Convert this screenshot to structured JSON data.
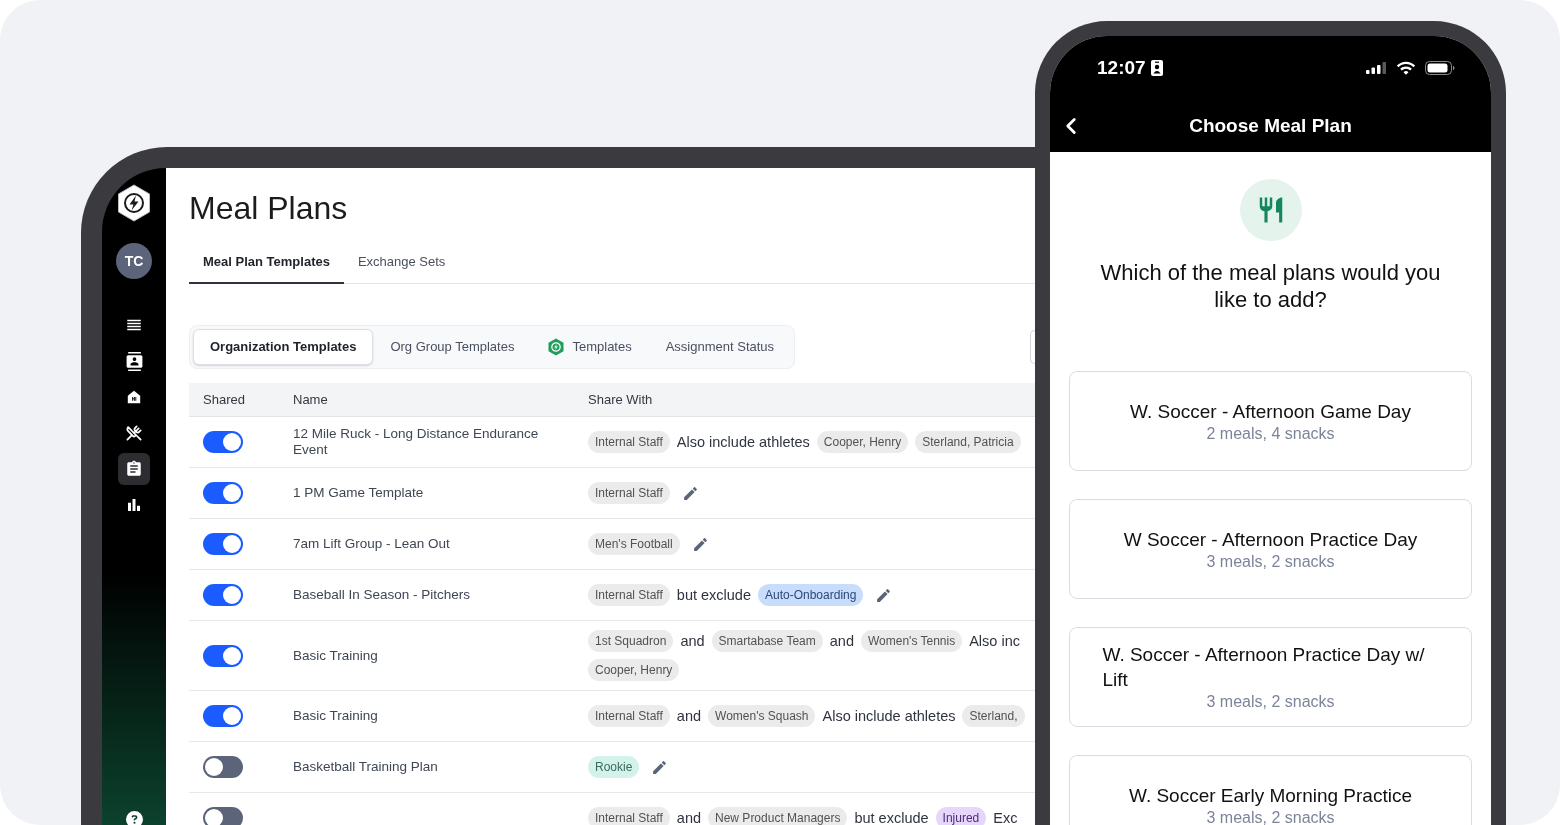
{
  "tablet": {
    "sidebar": {
      "avatar": "TC",
      "nav": [
        {
          "selected": false
        },
        {
          "selected": false
        },
        {
          "selected": false
        },
        {
          "selected": false
        },
        {
          "selected": true
        },
        {
          "selected": false
        }
      ]
    },
    "title": "Meal Plans",
    "tabs": [
      {
        "label": "Meal Plan Templates",
        "selected": true
      },
      {
        "label": "Exchange Sets",
        "selected": false
      }
    ],
    "segments": [
      {
        "label": "Organization Templates",
        "kind": "plain",
        "selected": true
      },
      {
        "label": "Org Group Templates",
        "kind": "plain",
        "selected": false
      },
      {
        "label": "Templates",
        "kind": "badged",
        "selected": false
      },
      {
        "label": "Assignment Status",
        "kind": "plain",
        "selected": false
      }
    ],
    "table": {
      "columns": [
        "Shared",
        "Name",
        "Share With"
      ],
      "rows": [
        {
          "shared": true,
          "name": "12 Mile Ruck - Long Distance Endurance Event",
          "share_with": [
            [
              {
                "kind": "chip",
                "text": "Internal Staff",
                "color": "#ebebeb"
              },
              {
                "kind": "text",
                "text": "Also include athletes"
              },
              {
                "kind": "chip",
                "text": "Cooper, Henry",
                "color": "#ebebeb"
              },
              {
                "kind": "chip",
                "text": "Sterland, Patricia",
                "color": "#ebebeb"
              }
            ]
          ]
        },
        {
          "shared": true,
          "name": "1 PM Game Template",
          "share_with": [
            [
              {
                "kind": "chip",
                "text": "Internal Staff",
                "color": "#ebebeb"
              },
              {
                "kind": "edit"
              }
            ]
          ]
        },
        {
          "shared": true,
          "name": "7am Lift Group - Lean Out",
          "share_with": [
            [
              {
                "kind": "chip",
                "text": "Men's Football",
                "color": "#ebebeb"
              },
              {
                "kind": "edit"
              }
            ]
          ]
        },
        {
          "shared": true,
          "name": "Baseball In Season - Pitchers",
          "share_with": [
            [
              {
                "kind": "chip",
                "text": "Internal Staff",
                "color": "#ebebeb"
              },
              {
                "kind": "text",
                "text": "but exclude"
              },
              {
                "kind": "chip",
                "text": "Auto-Onboarding",
                "color": "#c8dcfb"
              },
              {
                "kind": "edit"
              }
            ]
          ]
        },
        {
          "shared": true,
          "name": "Basic Training",
          "share_with": [
            [
              {
                "kind": "chip",
                "text": "1st Squadron",
                "color": "#ebebeb"
              },
              {
                "kind": "text",
                "text": "and"
              },
              {
                "kind": "chip",
                "text": "Smartabase Team",
                "color": "#ebebeb"
              },
              {
                "kind": "text",
                "text": "and"
              },
              {
                "kind": "chip",
                "text": "Women's Tennis",
                "color": "#ebebeb"
              },
              {
                "kind": "text",
                "text": "Also inc"
              }
            ],
            [
              {
                "kind": "chip",
                "text": "Cooper, Henry",
                "color": "#ebebeb"
              }
            ]
          ]
        },
        {
          "shared": true,
          "name": "Basic Training",
          "share_with": [
            [
              {
                "kind": "chip",
                "text": "Internal Staff",
                "color": "#ebebeb"
              },
              {
                "kind": "text",
                "text": "and"
              },
              {
                "kind": "chip",
                "text": "Women's Squash",
                "color": "#ebebeb"
              },
              {
                "kind": "text",
                "text": "Also include athletes"
              },
              {
                "kind": "chip",
                "text": "Sterland,",
                "color": "#ebebeb"
              }
            ]
          ]
        },
        {
          "shared": false,
          "name": "Basketball Training Plan",
          "share_with": [
            [
              {
                "kind": "chip",
                "text": "Rookie",
                "color": "#d3f2ea"
              },
              {
                "kind": "edit"
              }
            ]
          ]
        },
        {
          "shared": false,
          "share_with": [
            [
              {
                "kind": "chip",
                "text": "Internal Staff",
                "color": "#ebebeb"
              },
              {
                "kind": "text",
                "text": "and"
              },
              {
                "kind": "chip",
                "text": "New Product Managers",
                "color": "#ebebeb"
              },
              {
                "kind": "text",
                "text": "but exclude"
              },
              {
                "kind": "chip",
                "text": "Injured",
                "color": "#e6d6fb"
              },
              {
                "kind": "text",
                "text": "Exc"
              }
            ]
          ]
        }
      ]
    }
  },
  "phone": {
    "status_bar": {
      "time": "12:07"
    },
    "header": {
      "title": "Choose Meal Plan"
    },
    "question": "Which of the meal plans would you like to add?",
    "plans": [
      {
        "title": "W. Soccer - Afternoon Game Day",
        "summary": "2 meals, 4 snacks"
      },
      {
        "title": "W Soccer - Afternoon Practice Day",
        "summary": "3 meals, 2 snacks"
      },
      {
        "title": "W. Soccer - Afternoon Practice Day w/ Lift",
        "summary": "3 meals, 2 snacks"
      },
      {
        "title": "W. Soccer Early Morning Practice",
        "summary": "3 meals, 2 snacks"
      }
    ]
  }
}
